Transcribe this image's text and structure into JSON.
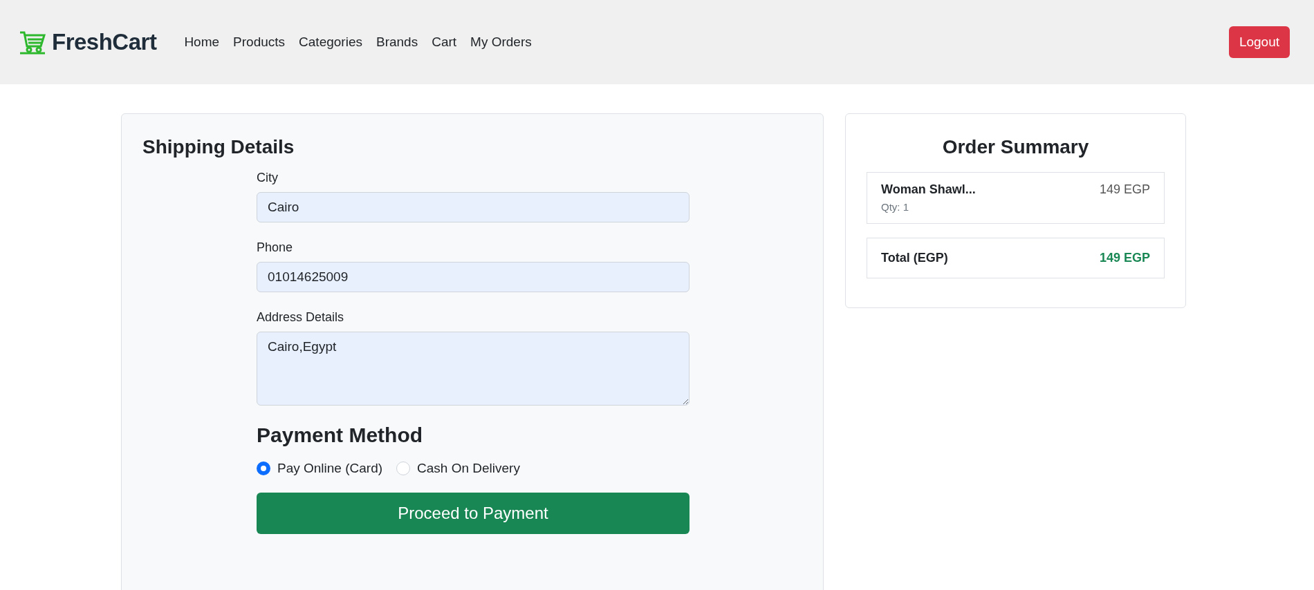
{
  "navbar": {
    "brand": "FreshCart",
    "links": [
      {
        "label": "Home"
      },
      {
        "label": "Products"
      },
      {
        "label": "Categories"
      },
      {
        "label": "Brands"
      },
      {
        "label": "Cart"
      },
      {
        "label": "My Orders"
      }
    ],
    "logout": "Logout"
  },
  "shipping": {
    "title": "Shipping Details",
    "fields": [
      {
        "kind": "input",
        "label": "City",
        "value": "Cairo"
      },
      {
        "kind": "input",
        "label": "Phone",
        "value": "01014625009"
      },
      {
        "kind": "textarea",
        "label": "Address Details",
        "value": "Cairo,Egypt"
      }
    ],
    "payment_title": "Payment Method",
    "payment_options": [
      {
        "label": "Pay Online (Card)",
        "selected": true
      },
      {
        "label": "Cash On Delivery",
        "selected": false
      }
    ],
    "submit": "Proceed to Payment"
  },
  "summary": {
    "title": "Order Summary",
    "items": [
      {
        "name": "Woman Shawl...",
        "qty": "Qty: 1",
        "price": "149 EGP"
      }
    ],
    "total_label": "Total (EGP)",
    "total_value": "149 EGP"
  }
}
